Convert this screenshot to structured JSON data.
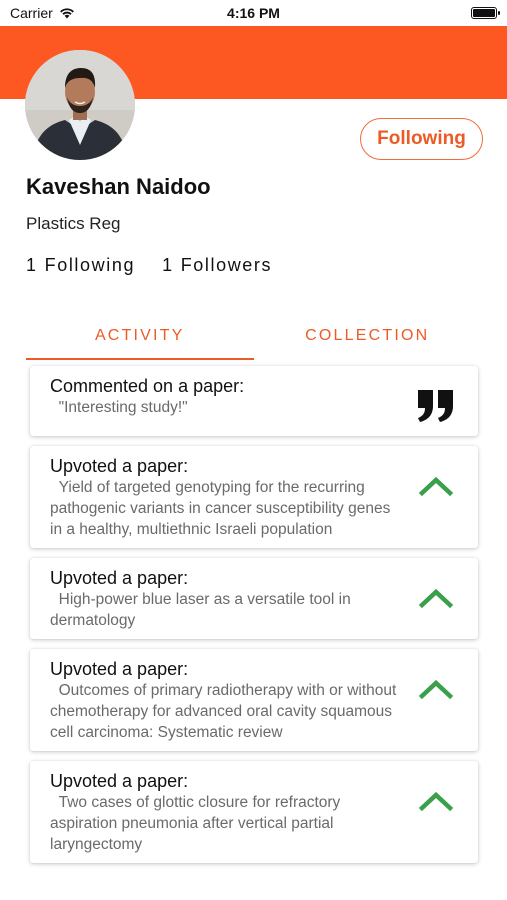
{
  "status_bar": {
    "carrier": "Carrier",
    "time": "4:16 PM"
  },
  "header": {
    "accent_color": "#fd5722"
  },
  "profile": {
    "name": "Kaveshan Naidoo",
    "role": "Plastics Reg",
    "following_count": "1",
    "following_label": "Following",
    "followers_count": "1",
    "followers_label": "Followers",
    "follow_button_label": "Following"
  },
  "tabs": [
    {
      "label": "ACTIVITY",
      "active": true
    },
    {
      "label": "COLLECTION",
      "active": false
    }
  ],
  "activity": [
    {
      "title": "Commented on a paper:",
      "body": "\"Interesting study!\"",
      "icon": "quote-icon"
    },
    {
      "title": "Upvoted a paper:",
      "body": "Yield of targeted genotyping for the recurring pathogenic variants in cancer susceptibility genes in a healthy, multiethnic Israeli population",
      "icon": "upvote-chevron-icon"
    },
    {
      "title": "Upvoted a paper:",
      "body": "High-power blue laser as a versatile tool in dermatology",
      "icon": "upvote-chevron-icon"
    },
    {
      "title": "Upvoted a paper:",
      "body": "Outcomes of primary radiotherapy with or without chemotherapy for advanced oral cavity squamous cell carcinoma: Systematic review",
      "icon": "upvote-chevron-icon"
    },
    {
      "title": "Upvoted a paper:",
      "body": "Two cases of glottic closure for refractory aspiration pneumonia after vertical partial laryngectomy",
      "icon": "upvote-chevron-icon"
    }
  ]
}
